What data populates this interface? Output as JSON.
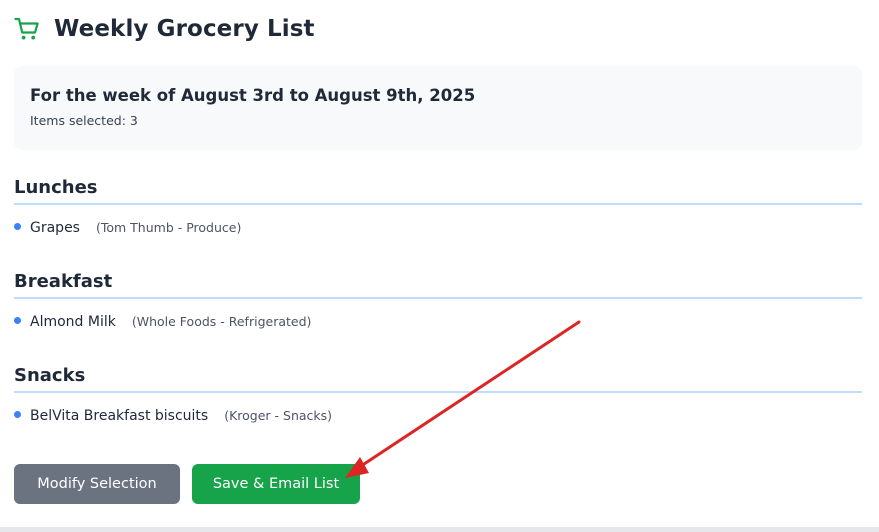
{
  "header": {
    "title": "Weekly Grocery List",
    "icon": "shopping-cart-icon",
    "icon_color": "#16a34a"
  },
  "summary": {
    "week_text": "For the week of August 3rd to August 9th, 2025",
    "items_selected": "Items selected: 3"
  },
  "sections": [
    {
      "title": "Lunches",
      "items": [
        {
          "name": "Grapes",
          "meta": "(Tom Thumb - Produce)"
        }
      ]
    },
    {
      "title": "Breakfast",
      "items": [
        {
          "name": "Almond Milk",
          "meta": "(Whole Foods - Refrigerated)"
        }
      ]
    },
    {
      "title": "Snacks",
      "items": [
        {
          "name": "BelVita Breakfast biscuits",
          "meta": "(Kroger - Snacks)"
        }
      ]
    }
  ],
  "actions": {
    "modify_label": "Modify Selection",
    "save_label": "Save & Email List"
  },
  "colors": {
    "accent_green": "#16a34a",
    "secondary_gray": "#6b7280",
    "bullet_blue": "#3b82f6",
    "divider_blue": "#bfdbfe",
    "annotation_red": "#dc2626"
  }
}
